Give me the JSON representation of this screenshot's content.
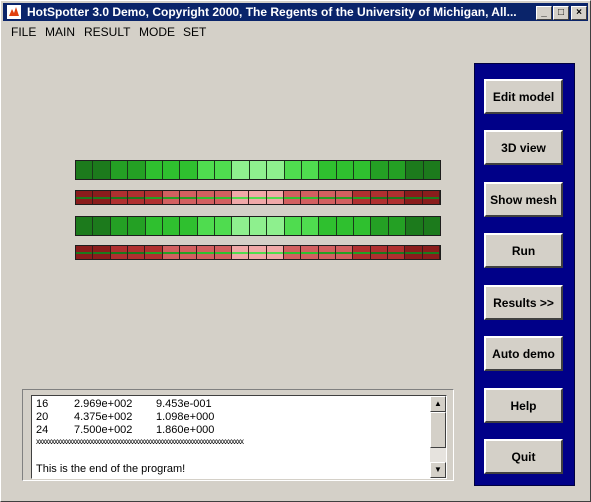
{
  "window": {
    "title": "HotSpotter 3.0 Demo,  Copyright 2000,  The Regents of the University of Michigan,  All...",
    "controls": [
      "minimize-icon",
      "maximize-icon",
      "close-icon"
    ]
  },
  "menu": [
    "FILE",
    "MAIN",
    "RESULT",
    "MODE",
    "SET"
  ],
  "buttons": [
    "Edit model",
    "3D view",
    "Show mesh",
    "Run",
    "Results >>",
    "Auto demo",
    "Help",
    "Quit"
  ],
  "console": {
    "rows": [
      [
        "16",
        "2.969e+002",
        "9.453e-001"
      ],
      [
        "20",
        "4.375e+002",
        "1.098e+000"
      ],
      [
        "24",
        "7.500e+002",
        "1.860e+000"
      ]
    ],
    "separator": "xxxxxxxxxxxxxxxxxxxxxxxxxxxxxxxxxxxxxxxxxxxxxxxxxxxxxxxxxxxxxxxxxxxxx",
    "blank": "",
    "end_message": "This is the end of the program!"
  },
  "colors": {
    "title_bar": "#0a246a",
    "panel": "#000088",
    "green_scale": [
      "#1c7a1c",
      "#24a024",
      "#2fc02f",
      "#4fdc4f",
      "#8ef08e"
    ],
    "red_scale": [
      "#8a1c1c",
      "#b03030",
      "#d26060",
      "#f0a8a8"
    ]
  }
}
